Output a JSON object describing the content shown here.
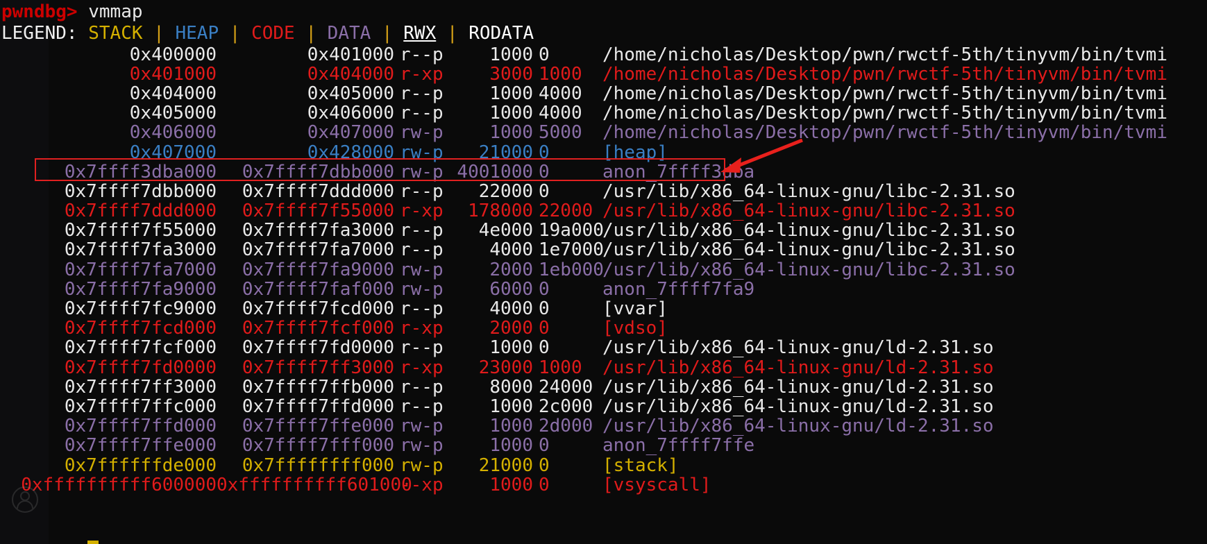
{
  "terminal": {
    "prompt": "pwndbg>",
    "command": "vmmap",
    "legend": {
      "label": "LEGEND:",
      "separator": "|",
      "items": [
        {
          "name": "STACK",
          "color": "#d4b000"
        },
        {
          "name": "HEAP",
          "color": "#3a7fc4"
        },
        {
          "name": "CODE",
          "color": "#e01b1b"
        },
        {
          "name": "DATA",
          "color": "#8b6fa8"
        },
        {
          "name": "RWX",
          "color": "#ffffff"
        },
        {
          "name": "RODATA",
          "color": "#ffffff"
        }
      ]
    },
    "colors": {
      "background": "#0a0a0a",
      "foreground": "#e9e9e9",
      "prompt": "#cc0000",
      "annotation": "#e02020"
    },
    "rows": [
      {
        "start": "0x400000",
        "end": "0x401000",
        "perm": "r--p",
        "size": "1000",
        "offset": "0",
        "objfile": "/home/nicholas/Desktop/pwn/rwctf-5th/tinyvm/bin/tvmi",
        "kind": "white"
      },
      {
        "start": "0x401000",
        "end": "0x404000",
        "perm": "r-xp",
        "size": "3000",
        "offset": "1000",
        "objfile": "/home/nicholas/Desktop/pwn/rwctf-5th/tinyvm/bin/tvmi",
        "kind": "code"
      },
      {
        "start": "0x404000",
        "end": "0x405000",
        "perm": "r--p",
        "size": "1000",
        "offset": "4000",
        "objfile": "/home/nicholas/Desktop/pwn/rwctf-5th/tinyvm/bin/tvmi",
        "kind": "white"
      },
      {
        "start": "0x405000",
        "end": "0x406000",
        "perm": "r--p",
        "size": "1000",
        "offset": "4000",
        "objfile": "/home/nicholas/Desktop/pwn/rwctf-5th/tinyvm/bin/tvmi",
        "kind": "white"
      },
      {
        "start": "0x406000",
        "end": "0x407000",
        "perm": "rw-p",
        "size": "1000",
        "offset": "5000",
        "objfile": "/home/nicholas/Desktop/pwn/rwctf-5th/tinyvm/bin/tvmi",
        "kind": "data"
      },
      {
        "start": "0x407000",
        "end": "0x428000",
        "perm": "rw-p",
        "size": "21000",
        "offset": "0",
        "objfile": "[heap]",
        "kind": "heap"
      },
      {
        "start": "0x7ffff3dba000",
        "end": "0x7ffff7dbb000",
        "perm": "rw-p",
        "size": "4001000",
        "offset": "0",
        "objfile": "anon_7ffff3dba",
        "kind": "data",
        "highlighted": true
      },
      {
        "start": "0x7ffff7dbb000",
        "end": "0x7ffff7ddd000",
        "perm": "r--p",
        "size": "22000",
        "offset": "0",
        "objfile": "/usr/lib/x86_64-linux-gnu/libc-2.31.so",
        "kind": "white"
      },
      {
        "start": "0x7ffff7ddd000",
        "end": "0x7ffff7f55000",
        "perm": "r-xp",
        "size": "178000",
        "offset": "22000",
        "objfile": "/usr/lib/x86_64-linux-gnu/libc-2.31.so",
        "kind": "code"
      },
      {
        "start": "0x7ffff7f55000",
        "end": "0x7ffff7fa3000",
        "perm": "r--p",
        "size": "4e000",
        "offset": "19a000",
        "objfile": "/usr/lib/x86_64-linux-gnu/libc-2.31.so",
        "kind": "white"
      },
      {
        "start": "0x7ffff7fa3000",
        "end": "0x7ffff7fa7000",
        "perm": "r--p",
        "size": "4000",
        "offset": "1e7000",
        "objfile": "/usr/lib/x86_64-linux-gnu/libc-2.31.so",
        "kind": "white"
      },
      {
        "start": "0x7ffff7fa7000",
        "end": "0x7ffff7fa9000",
        "perm": "rw-p",
        "size": "2000",
        "offset": "1eb000",
        "objfile": "/usr/lib/x86_64-linux-gnu/libc-2.31.so",
        "kind": "data"
      },
      {
        "start": "0x7ffff7fa9000",
        "end": "0x7ffff7faf000",
        "perm": "rw-p",
        "size": "6000",
        "offset": "0",
        "objfile": "anon_7ffff7fa9",
        "kind": "data"
      },
      {
        "start": "0x7ffff7fc9000",
        "end": "0x7ffff7fcd000",
        "perm": "r--p",
        "size": "4000",
        "offset": "0",
        "objfile": "[vvar]",
        "kind": "white"
      },
      {
        "start": "0x7ffff7fcd000",
        "end": "0x7ffff7fcf000",
        "perm": "r-xp",
        "size": "2000",
        "offset": "0",
        "objfile": "[vdso]",
        "kind": "code"
      },
      {
        "start": "0x7ffff7fcf000",
        "end": "0x7ffff7fd0000",
        "perm": "r--p",
        "size": "1000",
        "offset": "0",
        "objfile": "/usr/lib/x86_64-linux-gnu/ld-2.31.so",
        "kind": "white"
      },
      {
        "start": "0x7ffff7fd0000",
        "end": "0x7ffff7ff3000",
        "perm": "r-xp",
        "size": "23000",
        "offset": "1000",
        "objfile": "/usr/lib/x86_64-linux-gnu/ld-2.31.so",
        "kind": "code"
      },
      {
        "start": "0x7ffff7ff3000",
        "end": "0x7ffff7ffb000",
        "perm": "r--p",
        "size": "8000",
        "offset": "24000",
        "objfile": "/usr/lib/x86_64-linux-gnu/ld-2.31.so",
        "kind": "white"
      },
      {
        "start": "0x7ffff7ffc000",
        "end": "0x7ffff7ffd000",
        "perm": "r--p",
        "size": "1000",
        "offset": "2c000",
        "objfile": "/usr/lib/x86_64-linux-gnu/ld-2.31.so",
        "kind": "white"
      },
      {
        "start": "0x7ffff7ffd000",
        "end": "0x7ffff7ffe000",
        "perm": "rw-p",
        "size": "1000",
        "offset": "2d000",
        "objfile": "/usr/lib/x86_64-linux-gnu/ld-2.31.so",
        "kind": "data"
      },
      {
        "start": "0x7ffff7ffe000",
        "end": "0x7ffff7fff000",
        "perm": "rw-p",
        "size": "1000",
        "offset": "0",
        "objfile": "anon_7ffff7ffe",
        "kind": "data"
      },
      {
        "start": "0x7ffffffde000",
        "end": "0x7ffffffff000",
        "perm": "rw-p",
        "size": "21000",
        "offset": "0",
        "objfile": "[stack]",
        "kind": "stack"
      },
      {
        "start": "0xffffffffff600000",
        "end": "0xffffffffff601000",
        "perm": "--xp",
        "size": "1000",
        "offset": "0",
        "objfile": "[vsyscall]",
        "kind": "code"
      }
    ]
  },
  "annotations": {
    "highlight_box": {
      "target_row_index": 6,
      "color": "#e02020"
    },
    "arrow": {
      "direction": "left",
      "color": "#e02020"
    },
    "watermark": {
      "icon": "user-avatar-icon"
    }
  }
}
